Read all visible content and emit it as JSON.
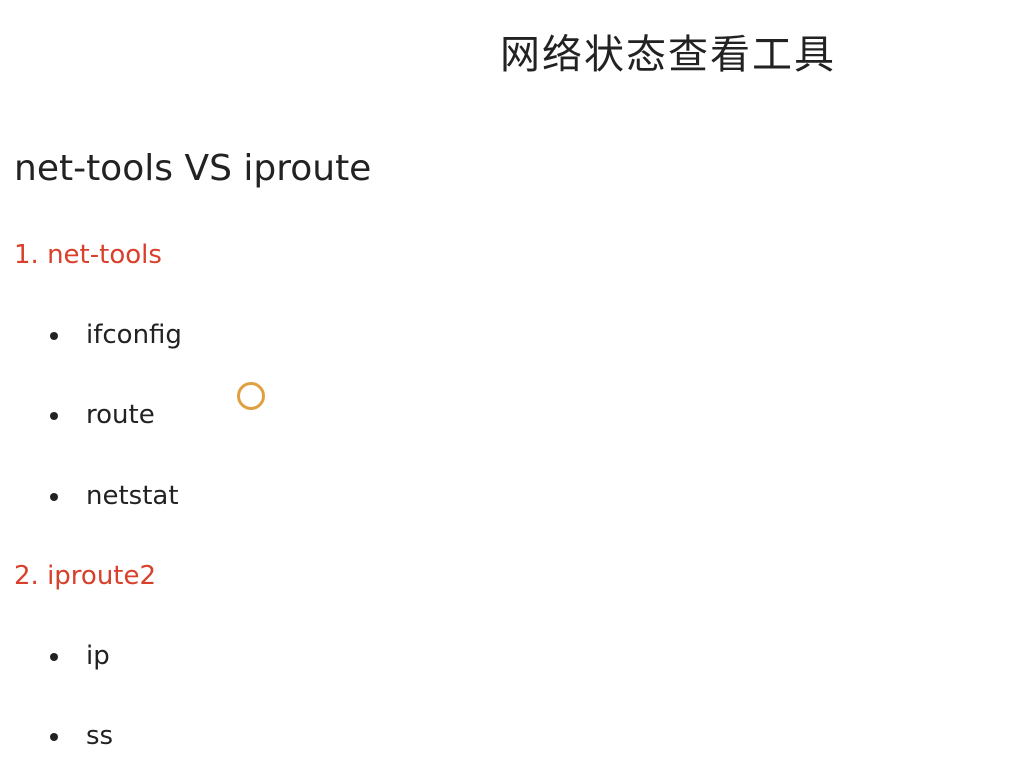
{
  "title": "网络状态查看工具",
  "subtitle": "net-tools VS iproute",
  "sections": [
    {
      "label": "1. net-tools",
      "items": [
        "ifconfig",
        "route",
        "netstat"
      ]
    },
    {
      "label": "2. iproute2",
      "items": [
        "ip",
        "ss"
      ]
    }
  ],
  "colors": {
    "section": "#d9402b",
    "text": "#222222",
    "cursor": "#e0a040"
  }
}
